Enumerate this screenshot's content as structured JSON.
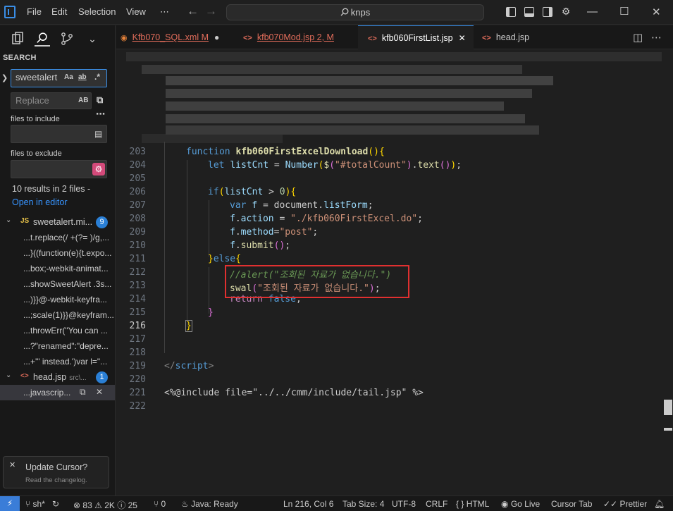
{
  "titlebar": {
    "menus": [
      "File",
      "Edit",
      "Selection",
      "View",
      "⋯"
    ],
    "search_text": "knps"
  },
  "sidebar": {
    "title": "SEARCH",
    "search_value": "sweetalert",
    "replace_placeholder": "Replace",
    "files_to_include_label": "files to include",
    "files_to_exclude_label": "files to exclude",
    "results_summary": "10 results in 2 files -",
    "open_in_editor": "Open in editor",
    "match_case": "Aa",
    "whole_word": "ab",
    "regex": ".*",
    "preserve_case": "AB",
    "files": [
      {
        "icon": "JS",
        "name": "sweetalert.mi...",
        "count": "9",
        "matches": [
          "...t.replace(/ +(?= )/g,...",
          "...}((function(e){t.expo...",
          "...box;-webkit-animat...",
          "...showSweetAlert .3s...",
          "...)}}@-webkit-keyfra...",
          "...;scale(1)}}@keyfram...",
          "...throwErr(\"You can ...",
          "...?\"renamed\":\"depre...",
          "...+'\" instead.')var l=\"..."
        ]
      },
      {
        "icon": "<>",
        "name": "head.jsp",
        "path": "src\\...",
        "count": "1",
        "matches": [
          "...javascrip..."
        ]
      }
    ],
    "toast_title": "Update Cursor?",
    "toast_sub": "Read the changelog."
  },
  "tabs": [
    {
      "icon": "rss",
      "label": "Kfb070_SQL.xml M",
      "state": "●",
      "color": "#e06c5a"
    },
    {
      "icon": "<>",
      "label": "kfb070Mod.jsp 2, M",
      "state": "",
      "color": "#e06c5a"
    },
    {
      "icon": "<>",
      "label": "kfb060FirstList.jsp",
      "state": "✕",
      "color": "#ffffff",
      "active": true
    },
    {
      "icon": "<>",
      "label": "head.jsp",
      "state": "",
      "color": "#cccccc"
    }
  ],
  "editor": {
    "current_line": "216",
    "line_numbers": [
      "203",
      "204",
      "205",
      "206",
      "207",
      "208",
      "209",
      "210",
      "211",
      "212",
      "213",
      "214",
      "215",
      "216",
      "217",
      "218",
      "219",
      "220",
      "221",
      "222"
    ]
  },
  "statusbar": {
    "branch": "sh*",
    "errors": "83",
    "warnings": "2K",
    "info": "25",
    "ports": "0",
    "java": "Java: Ready",
    "position": "Ln 216, Col 6",
    "tab_size": "Tab Size: 4",
    "encoding": "UTF-8",
    "eol": "CRLF",
    "language": "HTML",
    "go_live": "Go Live",
    "cursor_tab": "Cursor Tab",
    "prettier": "Prettier"
  }
}
